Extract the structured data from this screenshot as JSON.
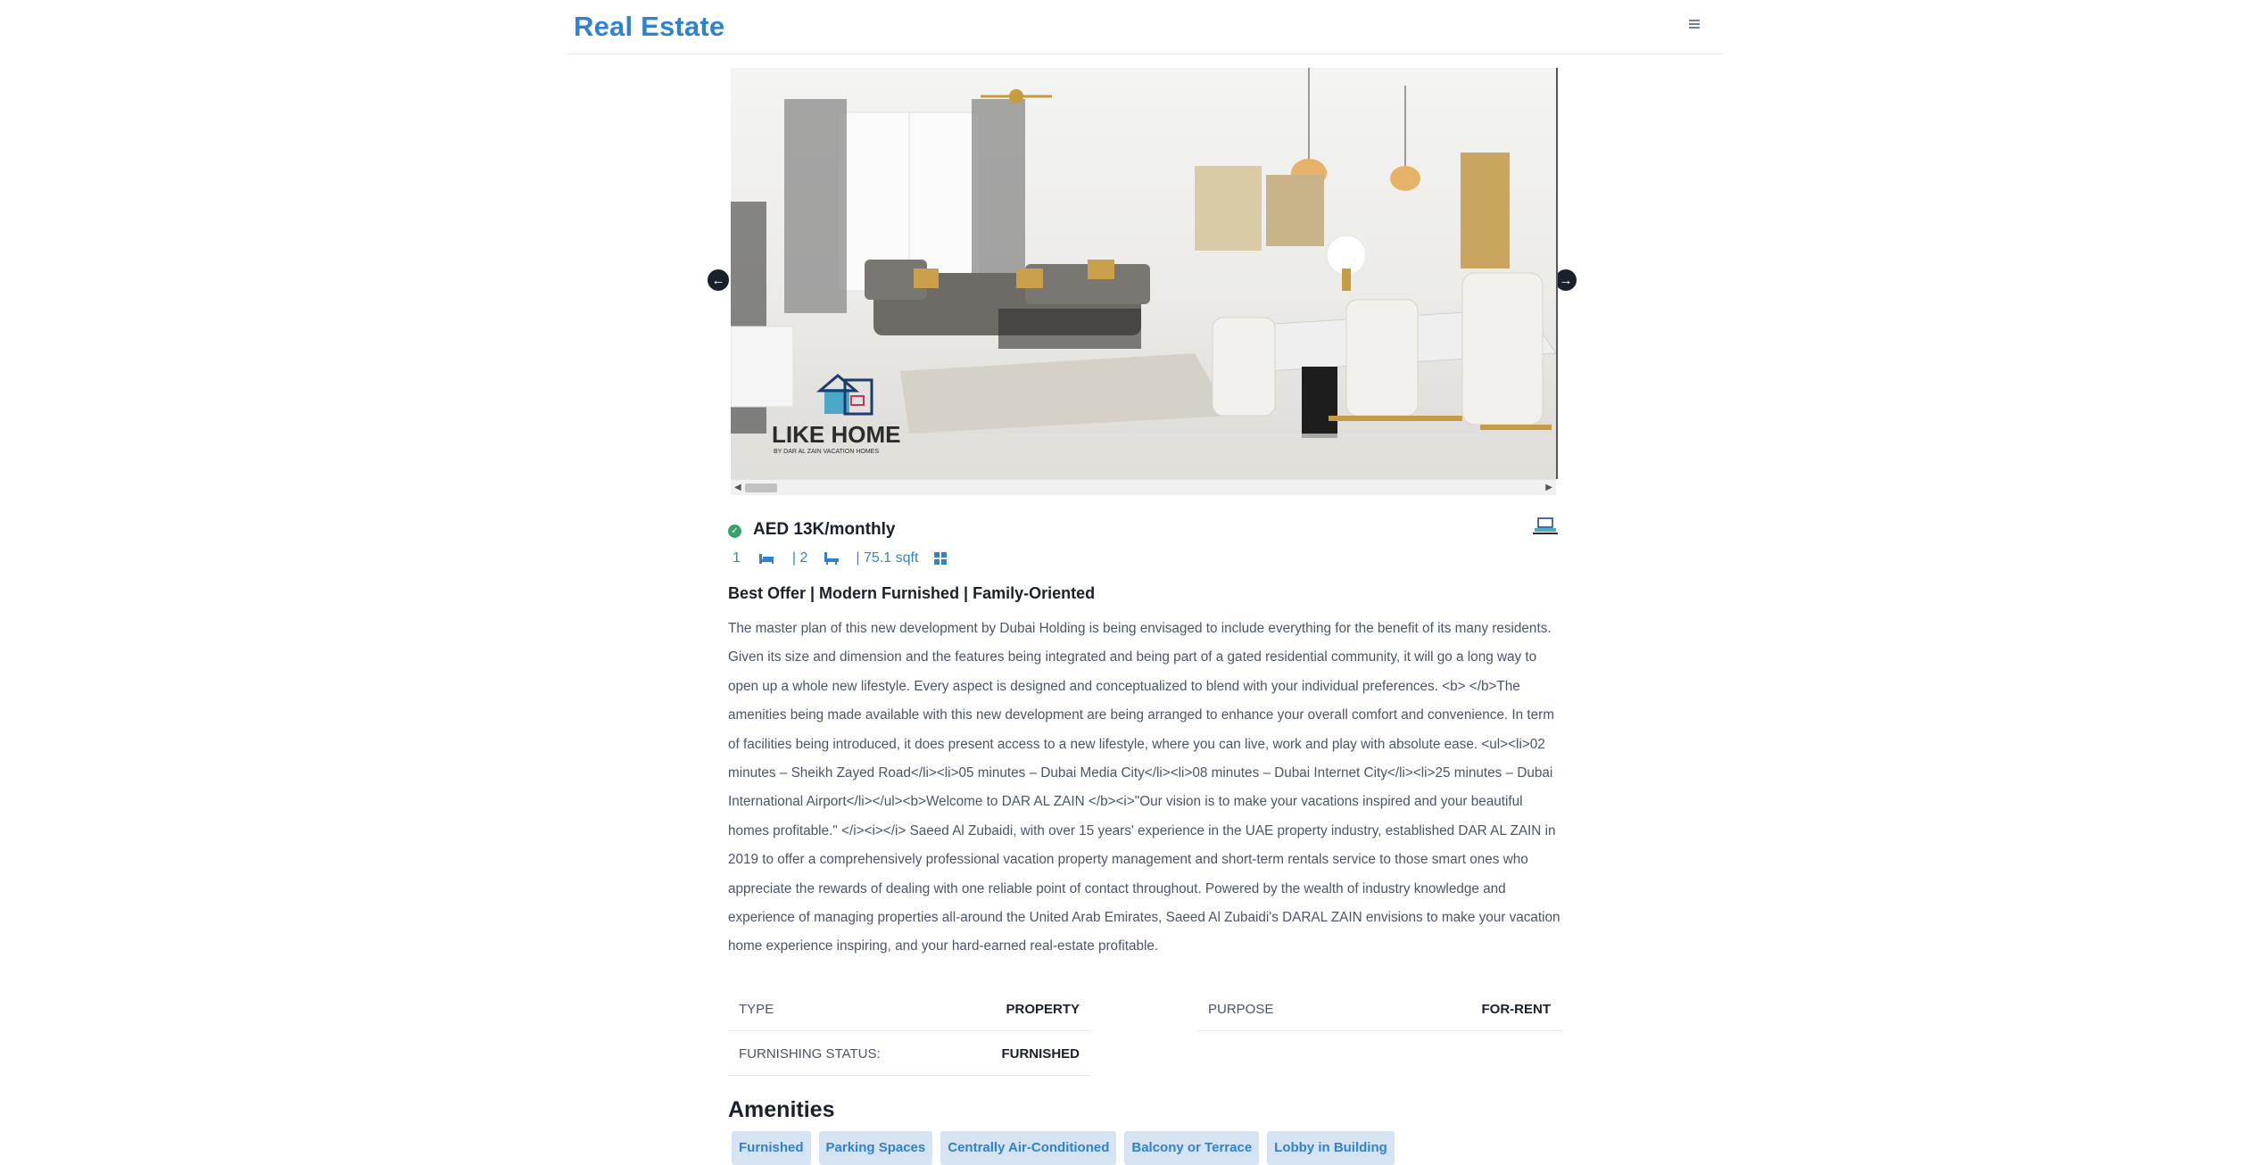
{
  "navbar": {
    "brand": "Real Estate",
    "menu_icon": "hamburger-icon"
  },
  "carousel": {
    "prev_icon": "arrow-left-icon",
    "next_icon": "arrow-right-icon",
    "watermark": {
      "title": "LIKE HOME",
      "subtitle": "BY DAR AL ZAIN VACATION HOMES"
    }
  },
  "listing": {
    "price": "AED 13K/monthly",
    "rooms": "1",
    "baths": "| 2",
    "area": "| 75.1 sqft",
    "title": "Best Offer | Modern Furnished | Family-Oriented",
    "description": "The master plan of this new development by Dubai Holding is being envisaged to include everything for the benefit of its many residents. Given its size and dimension and the features being integrated and being part of a gated residential community, it will go a long way to open up a whole new lifestyle. Every aspect is designed and conceptualized to blend with your individual preferences. <b> </b>The amenities being made available with this new development are being arranged to enhance your overall comfort and convenience. In term of facilities being introduced, it does present access to a new lifestyle, where you can live, work and play with absolute ease. <ul><li>02 minutes – Sheikh Zayed Road</li><li>05 minutes – Dubai Media City</li><li>08 minutes – Dubai Internet City</li><li>25 minutes – Dubai International Airport</li></ul><b>Welcome to DAR AL ZAIN </b><i>\"Our vision is to make your vacations inspired and your beautiful homes profitable.\" </i><i></i> Saeed Al Zubaidi, with over 15 years' experience in the UAE property industry, established DAR AL ZAIN in 2019 to offer a comprehensively professional vacation property management and short-term rentals service to those smart ones who appreciate the rewards of dealing with one reliable point of contact throughout. Powered by the wealth of industry knowledge and experience of managing properties all-around the United Arab Emirates, Saeed Al Zubaidi's DARAL ZAIN envisions to make your vacation home experience inspiring, and your hard-earned real-estate profitable."
  },
  "info": {
    "type_label": "TYPE",
    "type_value": "PROPERTY",
    "purpose_label": "PURPOSE",
    "purpose_value": "FOR-RENT",
    "furnishing_label": "FURNISHING STATUS:",
    "furnishing_value": "FURNISHED"
  },
  "amenities": {
    "title": "Amenities",
    "items": [
      "Furnished",
      "Parking Spaces",
      "Centrally Air-Conditioned",
      "Balcony or Terrace",
      "Lobby in Building"
    ]
  },
  "colors": {
    "accent": "#3182ce",
    "chip_bg": "#d5e3f2",
    "verified": "#38a169",
    "text": "#1a202c"
  }
}
